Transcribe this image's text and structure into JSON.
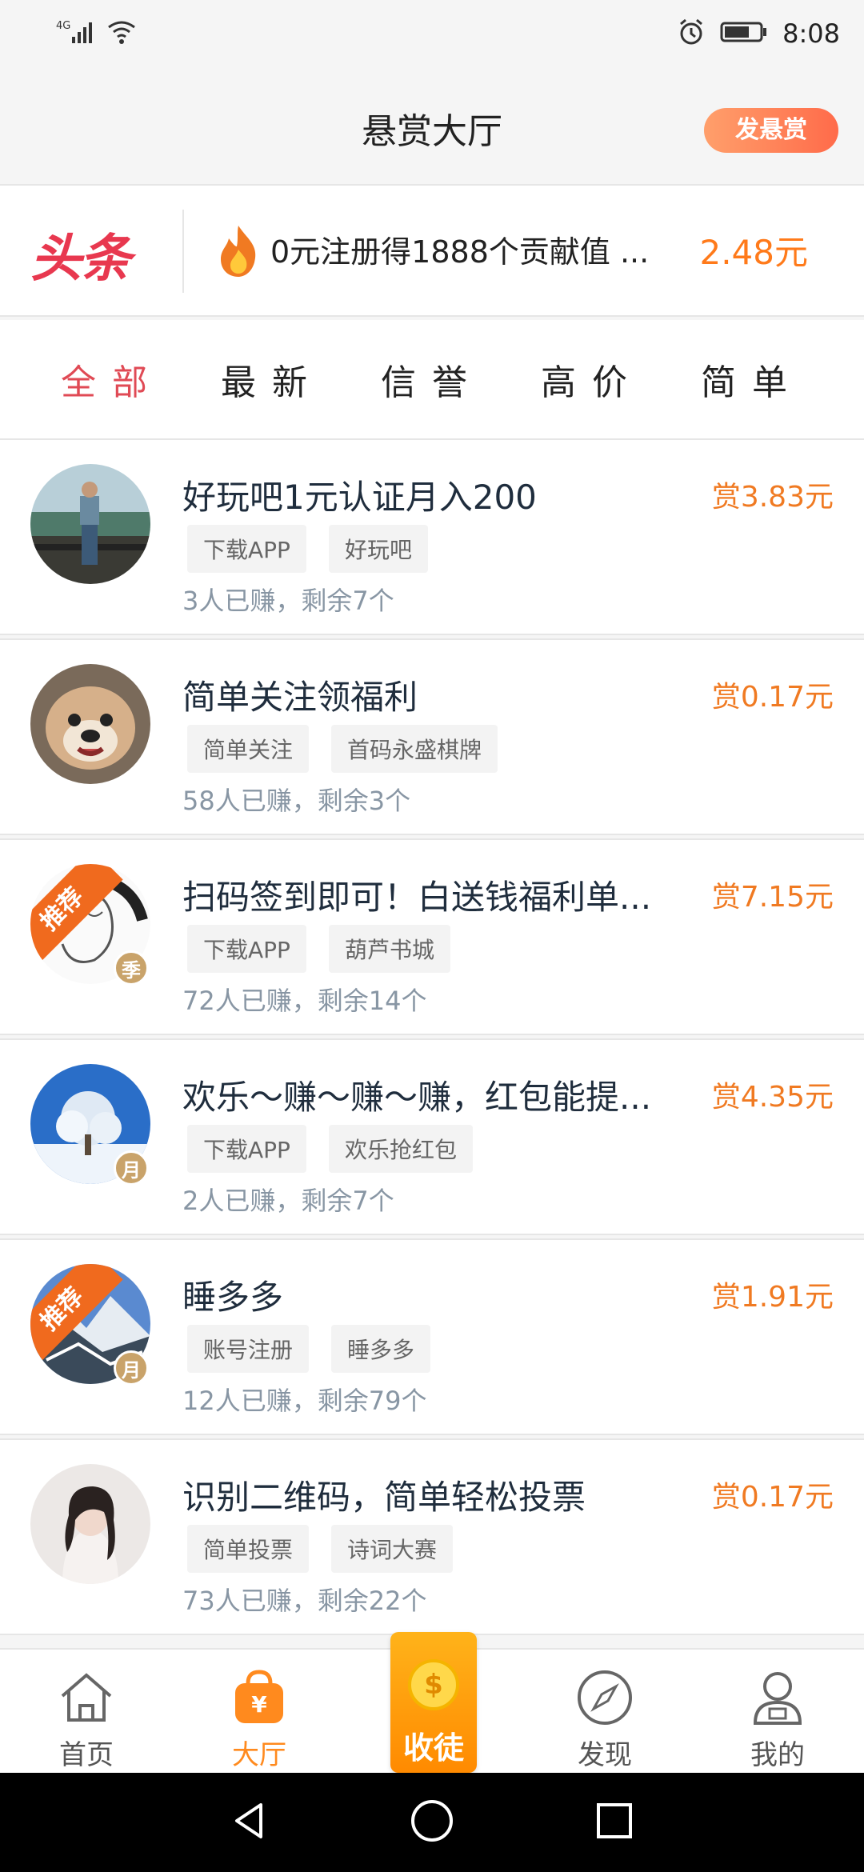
{
  "status_bar": {
    "signal_text": "4G",
    "time": "8:08"
  },
  "header": {
    "title": "悬赏大厅",
    "post_button": "发悬赏"
  },
  "banner": {
    "logo": "头条",
    "text": "0元注册得1888个贡献值 ...",
    "price": "2.48元",
    "accent": "#e8384f"
  },
  "filters": [
    {
      "label": "全部",
      "active": true
    },
    {
      "label": "最新",
      "active": false
    },
    {
      "label": "信誉",
      "active": false
    },
    {
      "label": "高价",
      "active": false
    },
    {
      "label": "简单",
      "active": false
    }
  ],
  "tasks": [
    {
      "title": "好玩吧1元认证月入200",
      "reward": "赏3.83元",
      "tags": [
        "下载APP",
        "好玩吧"
      ],
      "meta": "3人已赚，剩余7个",
      "avatar": "man-outdoor",
      "recommended": false,
      "badge": ""
    },
    {
      "title": "简单关注领福利",
      "reward": "赏0.17元",
      "tags": [
        "简单关注",
        "首码永盛棋牌"
      ],
      "meta": "58人已赚，剩余3个",
      "avatar": "bulldog",
      "recommended": false,
      "badge": ""
    },
    {
      "title": "扫码签到即可！白送钱福利单...",
      "reward": "赏7.15元",
      "tags": [
        "下载APP",
        "葫芦书城"
      ],
      "meta": "72人已赚，剩余14个",
      "avatar": "sketch",
      "recommended": true,
      "recommend_text": "推荐",
      "badge": "季"
    },
    {
      "title": "欢乐～赚～赚～赚，红包能提...",
      "reward": "赏4.35元",
      "tags": [
        "下载APP",
        "欢乐抢红包"
      ],
      "meta": "2人已赚，剩余7个",
      "avatar": "snow-tree",
      "recommended": false,
      "badge": "月"
    },
    {
      "title": "睡多多",
      "reward": "赏1.91元",
      "tags": [
        "账号注册",
        "睡多多"
      ],
      "meta": "12人已赚，剩余79个",
      "avatar": "mountain",
      "recommended": true,
      "recommend_text": "推荐",
      "badge": "月"
    },
    {
      "title": "识别二维码，简单轻松投票",
      "reward": "赏0.17元",
      "tags": [
        "简单投票",
        "诗词大赛"
      ],
      "meta": "73人已赚，剩余22个",
      "avatar": "woman",
      "recommended": false,
      "badge": ""
    }
  ],
  "bottom_nav": [
    {
      "label": "首页",
      "icon": "home-icon",
      "active": false
    },
    {
      "label": "大厅",
      "icon": "hall-bag-icon",
      "active": true
    },
    {
      "label": "收徒",
      "icon": "coin-icon",
      "active": false
    },
    {
      "label": "发现",
      "icon": "compass-icon",
      "active": false
    },
    {
      "label": "我的",
      "icon": "user-icon",
      "active": false
    }
  ],
  "colors": {
    "active_tab": "#e04a55",
    "reward": "#f07a22",
    "active_nav": "#ff8a1e"
  }
}
